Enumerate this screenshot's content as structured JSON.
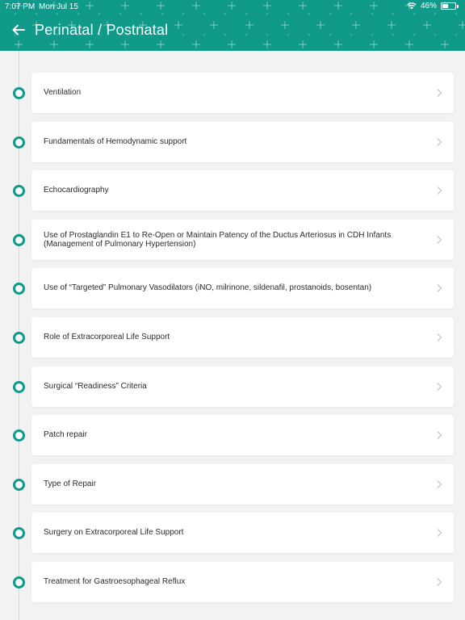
{
  "status_bar": {
    "time": "7:07 PM",
    "date": "Mon Jul 15",
    "battery": "46%",
    "battery_level": 0.46
  },
  "header": {
    "title": "Perinatal / Postnatal",
    "back_icon": "arrow-left-icon",
    "background_color": "#0f9a8a"
  },
  "accent_color": "#0f9a8a",
  "items": [
    {
      "label": "Ventilation"
    },
    {
      "label": "Fundamentals of Hemodynamic support"
    },
    {
      "label": "Echocardiography"
    },
    {
      "label": "Use of Prostaglandin E1 to Re-Open or Maintain Patency of the Ductus Arteriosus in CDH Infants (Management of Pulmonary Hypertension)"
    },
    {
      "label": "Use of “Targeted” Pulmonary Vasodilators (iNO, milrinone, sildenafil, prostanoids, bosentan)"
    },
    {
      "label": "Role of Extracorporeal Life Support"
    },
    {
      "label": "Surgical “Readiness” Criteria"
    },
    {
      "label": "Patch repair"
    },
    {
      "label": "Type of Repair"
    },
    {
      "label": "Surgery on Extracorporeal Life Support"
    },
    {
      "label": "Treatment for Gastroesophageal Reflux"
    }
  ]
}
